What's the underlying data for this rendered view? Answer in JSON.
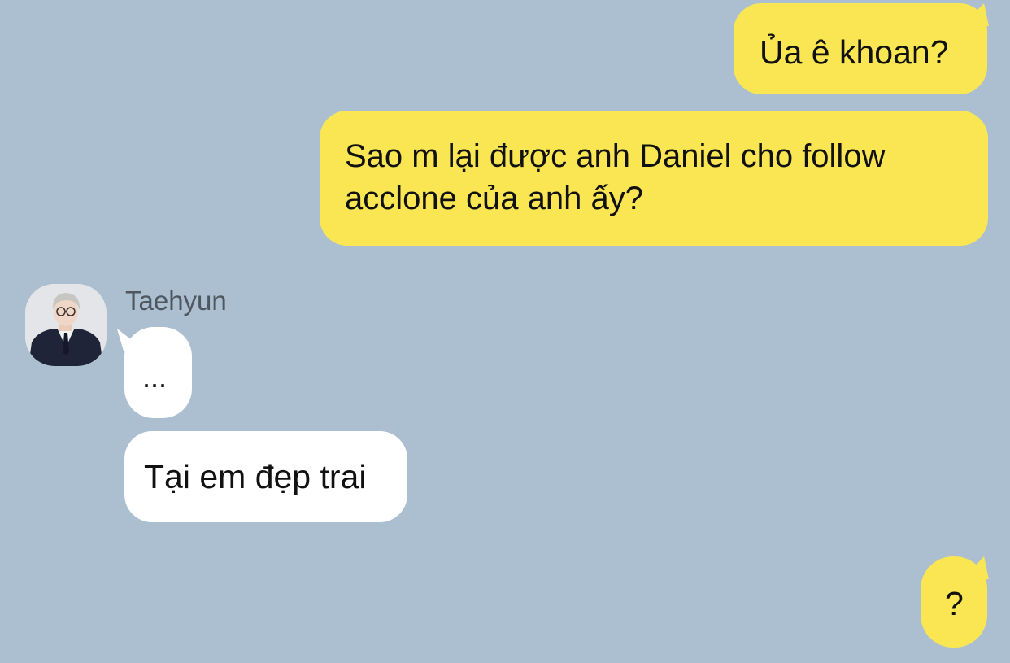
{
  "colors": {
    "background": "#acbfd0",
    "outgoing_bubble": "#f9e652",
    "incoming_bubble": "#ffffff",
    "sender_name": "#4e5660"
  },
  "messages": [
    {
      "direction": "outgoing",
      "text": "Ủa ê khoan?"
    },
    {
      "direction": "outgoing",
      "text": "Sao m lại được anh Daniel cho follow acclone của anh ấy?"
    },
    {
      "direction": "incoming",
      "text": "..."
    },
    {
      "direction": "incoming",
      "text": "Tại em đẹp trai"
    },
    {
      "direction": "outgoing",
      "text": "?"
    }
  ],
  "sender": {
    "name": "Taehyun",
    "avatar_icon": "user-avatar-icon"
  }
}
